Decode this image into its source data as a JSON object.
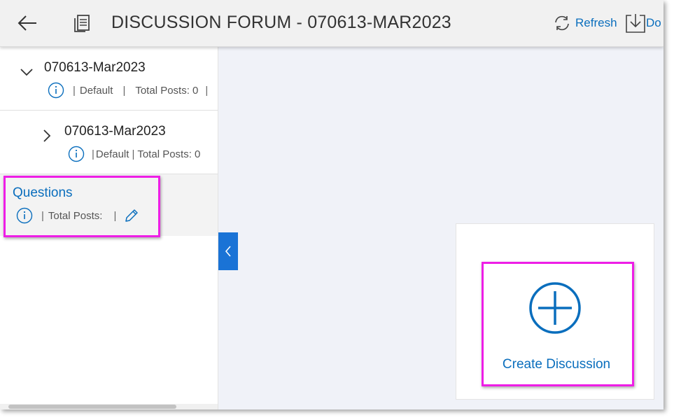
{
  "header": {
    "title": "DISCUSSION FORUM - 070613-MAR2023",
    "refresh_label": "Refresh",
    "download_label": "Do",
    "icons": {
      "back": "arrow-left-icon",
      "forum": "forum-icon",
      "refresh": "refresh-icon",
      "download": "download-icon"
    }
  },
  "sidebar": {
    "nodes": [
      {
        "title": "070613-Mar2023",
        "expanded": true,
        "meta_default": "Default",
        "meta_posts": "Total Posts: 0",
        "trailing_sep": "|"
      },
      {
        "title": "070613-Mar2023",
        "expanded": false,
        "meta_default": "Default",
        "meta_posts": "Total Posts: 0"
      },
      {
        "title": "Questions",
        "meta_posts": "Total Posts:",
        "selected": true
      }
    ],
    "sep": "|"
  },
  "main": {
    "create_label": "Create Discussion"
  },
  "colors": {
    "accent": "#0a6ebd",
    "highlight": "#ee1ee6",
    "collapse_button": "#1a73d6",
    "main_bg": "#f0f2f8"
  }
}
